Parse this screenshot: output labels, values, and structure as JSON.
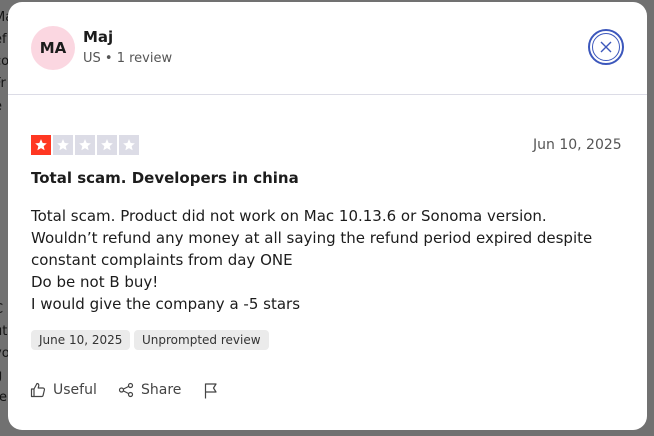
{
  "background": {
    "left_fragments": [
      "Ma",
      "ef",
      "co",
      "Fr",
      "e",
      "C",
      "ut",
      "vo",
      "g",
      "re"
    ]
  },
  "reviewer": {
    "initials": "MA",
    "name": "Maj",
    "meta": "US • 1 review"
  },
  "review": {
    "rating": 1,
    "max_rating": 5,
    "date": "Jun 10, 2025",
    "title": "Total scam. Developers in china",
    "body_lines": [
      "Total scam. Product did not work on Mac 10.13.6 or Sonoma version.",
      "Wouldn’t refund any money at all saying the refund period expired despite",
      "constant complaints from day ONE",
      "Do be not B buy!",
      "I would give the company a -5 stars"
    ],
    "tags": [
      "June 10, 2025",
      "Unprompted review"
    ]
  },
  "actions": {
    "useful_label": "Useful",
    "share_label": "Share"
  },
  "icons": {
    "close": "close-icon",
    "star": "star-icon",
    "useful": "thumbs-up-icon",
    "share": "share-icon",
    "flag": "flag-icon"
  },
  "colors": {
    "star_filled": "#ff3722",
    "star_empty": "#dcdce6",
    "avatar_bg": "#fbd7e1",
    "close_ring": "#3c57bc"
  }
}
